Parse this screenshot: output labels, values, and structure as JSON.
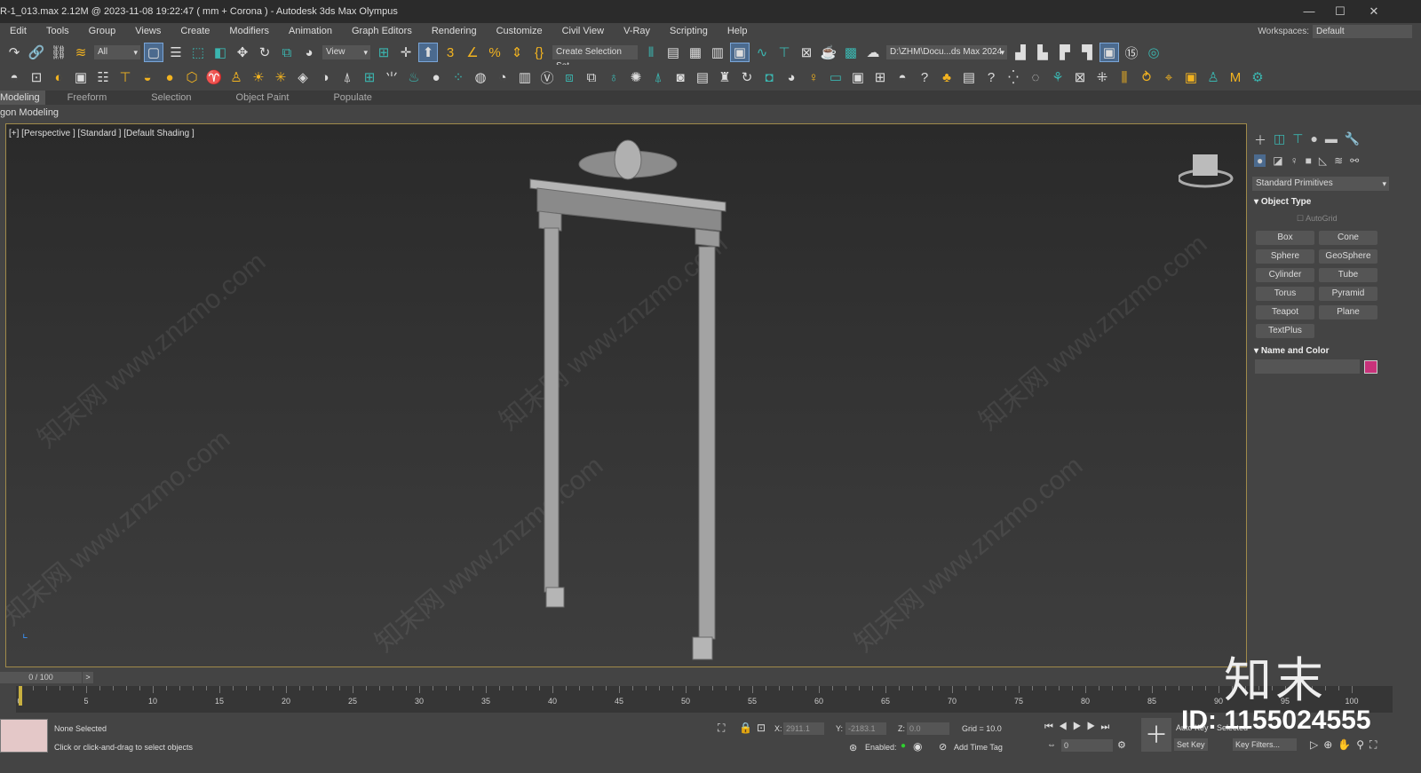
{
  "title": "R-1_013.max  2.12M @ 2023-11-08 19:22:47  ( mm + Corona ) - Autodesk 3ds Max Olympus",
  "window_controls": [
    "—",
    "☐",
    "✕"
  ],
  "menu": [
    "Edit",
    "Tools",
    "Group",
    "Views",
    "Create",
    "Modifiers",
    "Animation",
    "Graph Editors",
    "Rendering",
    "Customize",
    "Civil View",
    "V-Ray",
    "Scripting",
    "Help"
  ],
  "workspace": {
    "label": "Workspaces:",
    "value": "Default"
  },
  "toolbar": {
    "filter": "All",
    "ref_coord": "View",
    "selection_set": "Create Selection Set",
    "project_path": "D:\\ZHM\\Docu...ds Max 2024"
  },
  "ribbon": {
    "tabs": [
      "Modeling",
      "Freeform",
      "Selection",
      "Object Paint",
      "Populate"
    ],
    "sub": "gon Modeling"
  },
  "viewport": {
    "label": "[+] [Perspective ] [Standard ] [Default Shading ]",
    "watermark": "知末网 www.znzmo.com"
  },
  "panel": {
    "category": "Standard Primitives",
    "object_type": "Object Type",
    "autogrid": "AutoGrid",
    "buttons": [
      "Box",
      "Cone",
      "Sphere",
      "GeoSphere",
      "Cylinder",
      "Tube",
      "Torus",
      "Pyramid",
      "Teapot",
      "Plane",
      "TextPlus"
    ],
    "name_color": "Name and Color",
    "color": "#c8327a"
  },
  "timeline": {
    "slider": "0 / 100",
    "next": ">",
    "ticks": [
      "0",
      "5",
      "10",
      "15",
      "20",
      "25",
      "30",
      "35",
      "40",
      "45",
      "50",
      "55",
      "60",
      "65",
      "70",
      "75",
      "80",
      "85",
      "90",
      "95",
      "100"
    ]
  },
  "status": {
    "selected": "None Selected",
    "prompt": "Click or click-and-drag to select objects",
    "x_label": "X:",
    "x": "2911.1",
    "y_label": "Y:",
    "y": "-2183.1",
    "z_label": "Z:",
    "z": "0.0",
    "grid": "Grid = 10.0",
    "enabled": "Enabled:",
    "add_time_tag": "Add Time Tag",
    "auto_key": "Auto Key",
    "selected_label": "Selected",
    "set_key": "Set Key",
    "key_filters": "Key Filters...",
    "frame": "0"
  },
  "watermarks": {
    "logo": "知末",
    "id": "ID: 1155024555"
  }
}
